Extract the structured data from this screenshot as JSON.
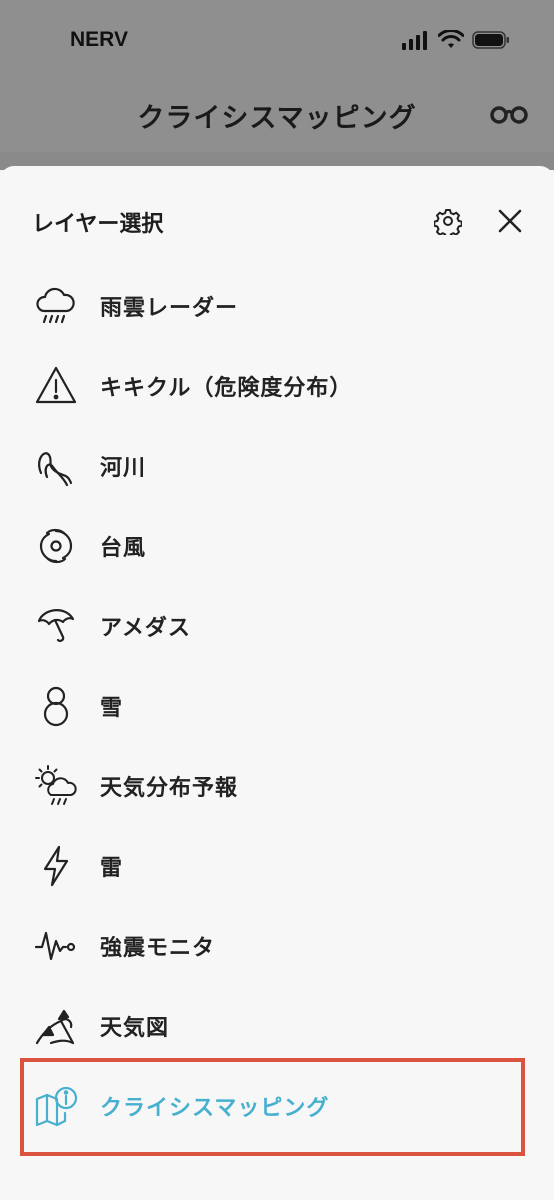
{
  "status_bar": {
    "carrier": "NERV"
  },
  "header": {
    "title": "クライシスマッピング"
  },
  "sheet": {
    "title": "レイヤー選択",
    "items": [
      {
        "label": "雨雲レーダー",
        "icon": "rain-cloud-icon"
      },
      {
        "label": "キキクル（危険度分布）",
        "icon": "warning-triangle-icon"
      },
      {
        "label": "河川",
        "icon": "river-icon"
      },
      {
        "label": "台風",
        "icon": "typhoon-icon"
      },
      {
        "label": "アメダス",
        "icon": "umbrella-icon"
      },
      {
        "label": "雪",
        "icon": "snowman-icon"
      },
      {
        "label": "天気分布予報",
        "icon": "sun-cloud-rain-icon"
      },
      {
        "label": "雷",
        "icon": "lightning-icon"
      },
      {
        "label": "強震モニタ",
        "icon": "seismic-wave-icon"
      },
      {
        "label": "天気図",
        "icon": "weather-front-icon"
      },
      {
        "label": "クライシスマッピング",
        "icon": "map-info-icon",
        "selected": true
      }
    ]
  },
  "colors": {
    "accent": "#48b0cf",
    "highlight": "#d9533e",
    "header_bg": "#8f8f8f"
  }
}
